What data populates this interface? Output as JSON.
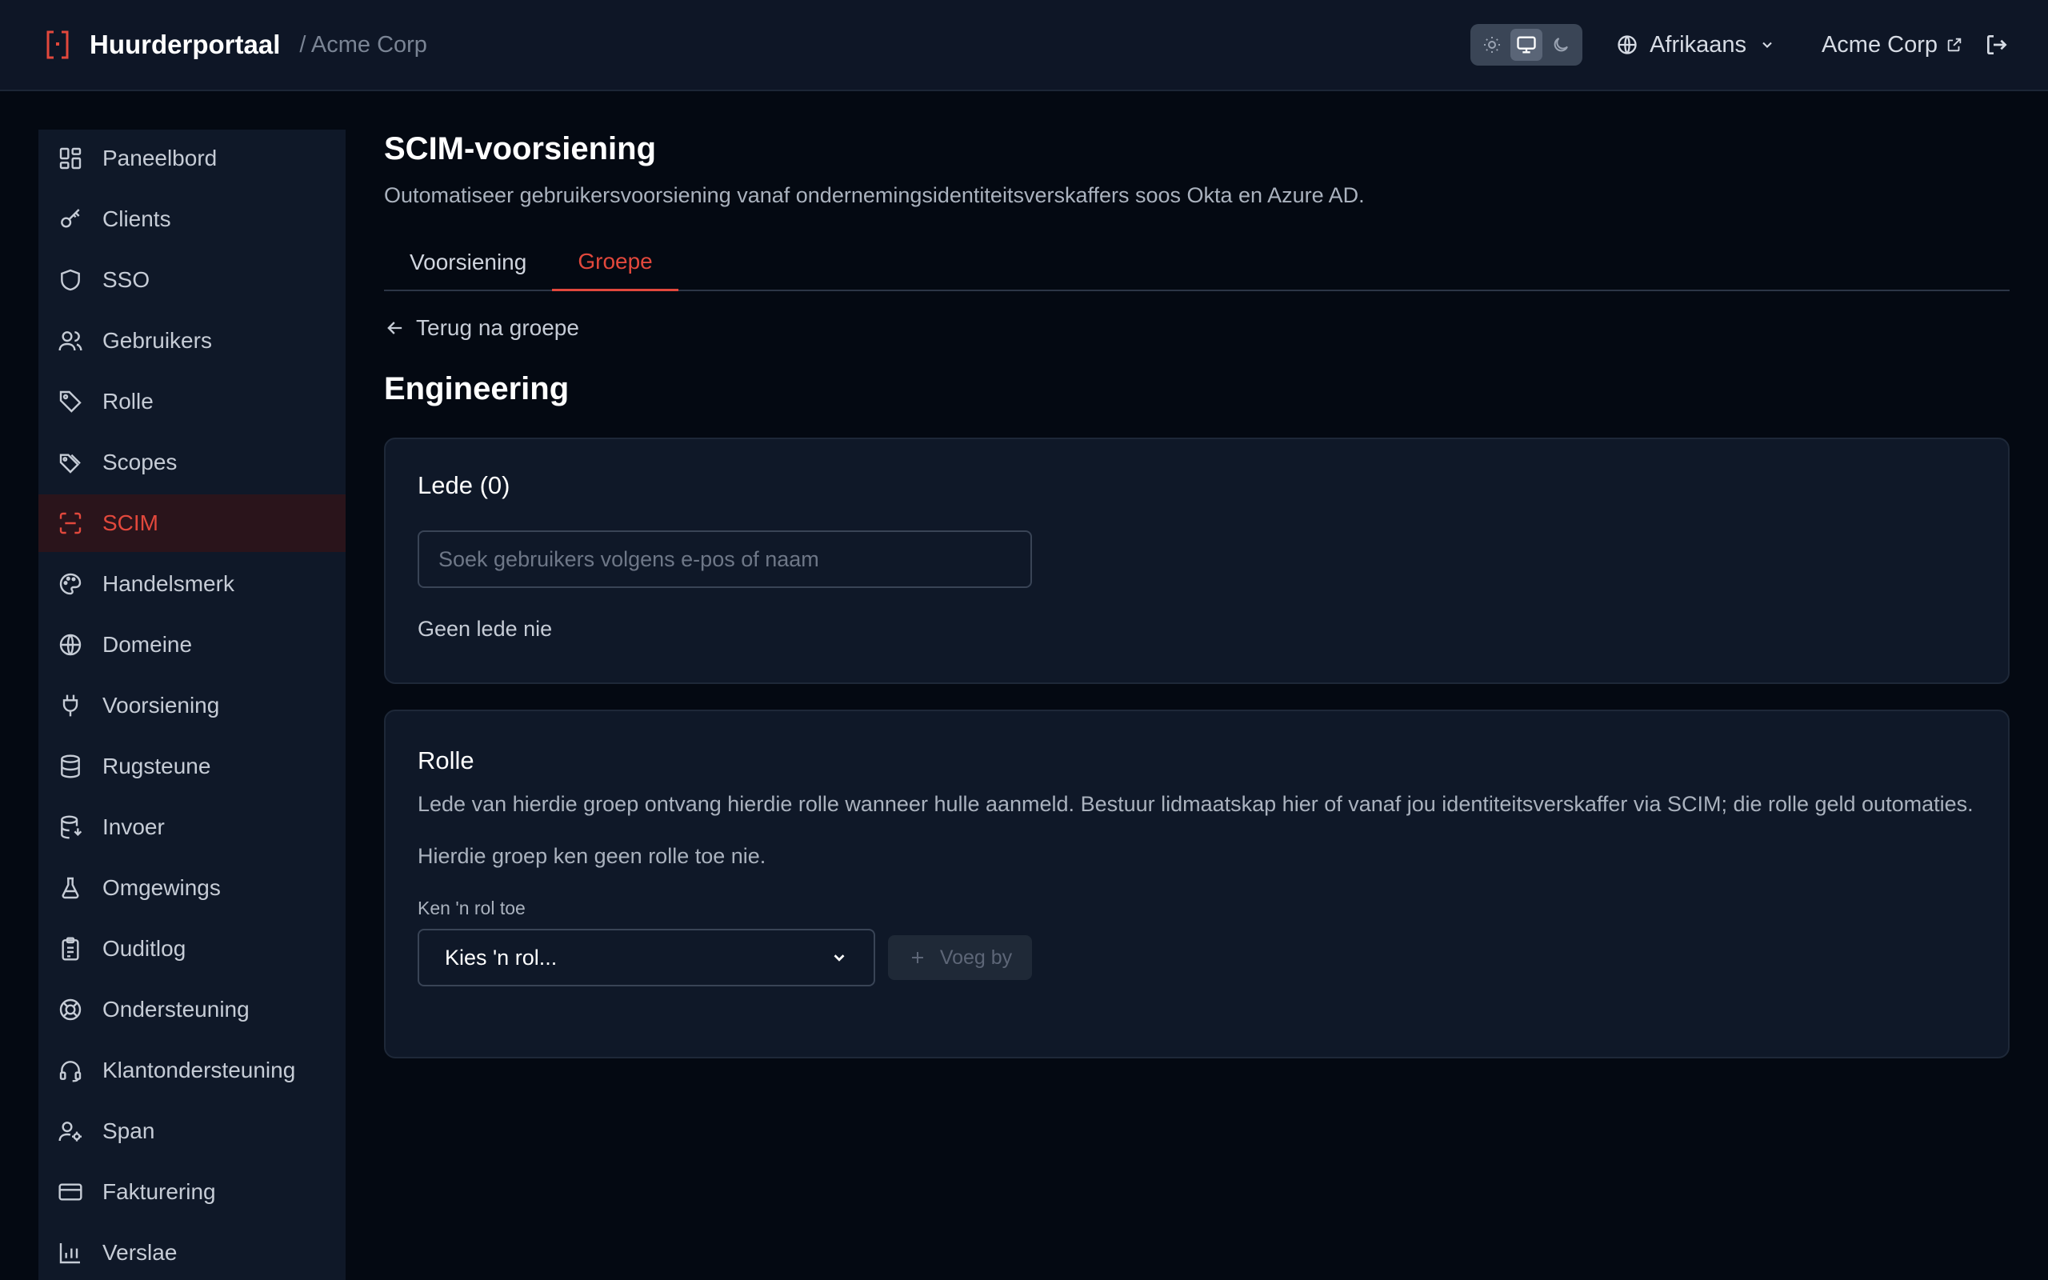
{
  "header": {
    "brand": "Huurderportaal",
    "separator": "/ Acme Corp",
    "theme_modes": [
      "light-icon",
      "monitor-icon",
      "moon-icon"
    ],
    "theme_active": "monitor-icon",
    "language": "Afrikaans",
    "organization": "Acme Corp",
    "accent_color": "#e2483c"
  },
  "sidebar": {
    "items": [
      {
        "label": "Paneelbord",
        "icon": "dashboard-icon"
      },
      {
        "label": "Clients",
        "icon": "key-icon"
      },
      {
        "label": "SSO",
        "icon": "shield-icon"
      },
      {
        "label": "Gebruikers",
        "icon": "users-icon"
      },
      {
        "label": "Rolle",
        "icon": "tag-icon"
      },
      {
        "label": "Scopes",
        "icon": "tags-icon"
      },
      {
        "label": "SCIM",
        "icon": "scan-icon",
        "active": true
      },
      {
        "label": "Handelsmerk",
        "icon": "palette-icon"
      },
      {
        "label": "Domeine",
        "icon": "globe-icon"
      },
      {
        "label": "Voorsiening",
        "icon": "plug-icon"
      },
      {
        "label": "Rugsteune",
        "icon": "database-icon"
      },
      {
        "label": "Invoer",
        "icon": "database-import-icon"
      },
      {
        "label": "Omgewings",
        "icon": "flask-icon"
      },
      {
        "label": "Ouditlog",
        "icon": "clipboard-icon"
      },
      {
        "label": "Ondersteuning",
        "icon": "lifebuoy-icon"
      },
      {
        "label": "Klantondersteuning",
        "icon": "headset-icon"
      },
      {
        "label": "Span",
        "icon": "user-cog-icon"
      },
      {
        "label": "Fakturering",
        "icon": "credit-card-icon"
      },
      {
        "label": "Verslae",
        "icon": "bar-chart-icon"
      }
    ]
  },
  "main": {
    "title": "SCIM-voorsiening",
    "description": "Outomatiseer gebruikersvoorsiening vanaf ondernemingsidentiteitsverskaffers soos Okta en Azure AD.",
    "tabs": [
      {
        "label": "Voorsiening",
        "active": false
      },
      {
        "label": "Groepe",
        "active": true
      }
    ],
    "back_label": "Terug na groepe",
    "group_name": "Engineering",
    "members": {
      "title": "Lede (0)",
      "search_placeholder": "Soek gebruikers volgens e-pos of naam",
      "empty": "Geen lede nie"
    },
    "roles": {
      "title": "Rolle",
      "description": "Lede van hierdie groep ontvang hierdie rolle wanneer hulle aanmeld. Bestuur lidmaatskap hier of vanaf jou identiteitsverskaffer via SCIM; die rolle geld outomaties.",
      "none": "Hierdie groep ken geen rolle toe nie.",
      "assign_label": "Ken 'n rol toe",
      "select_value": "Kies 'n rol...",
      "add_label": "Voeg by"
    }
  }
}
